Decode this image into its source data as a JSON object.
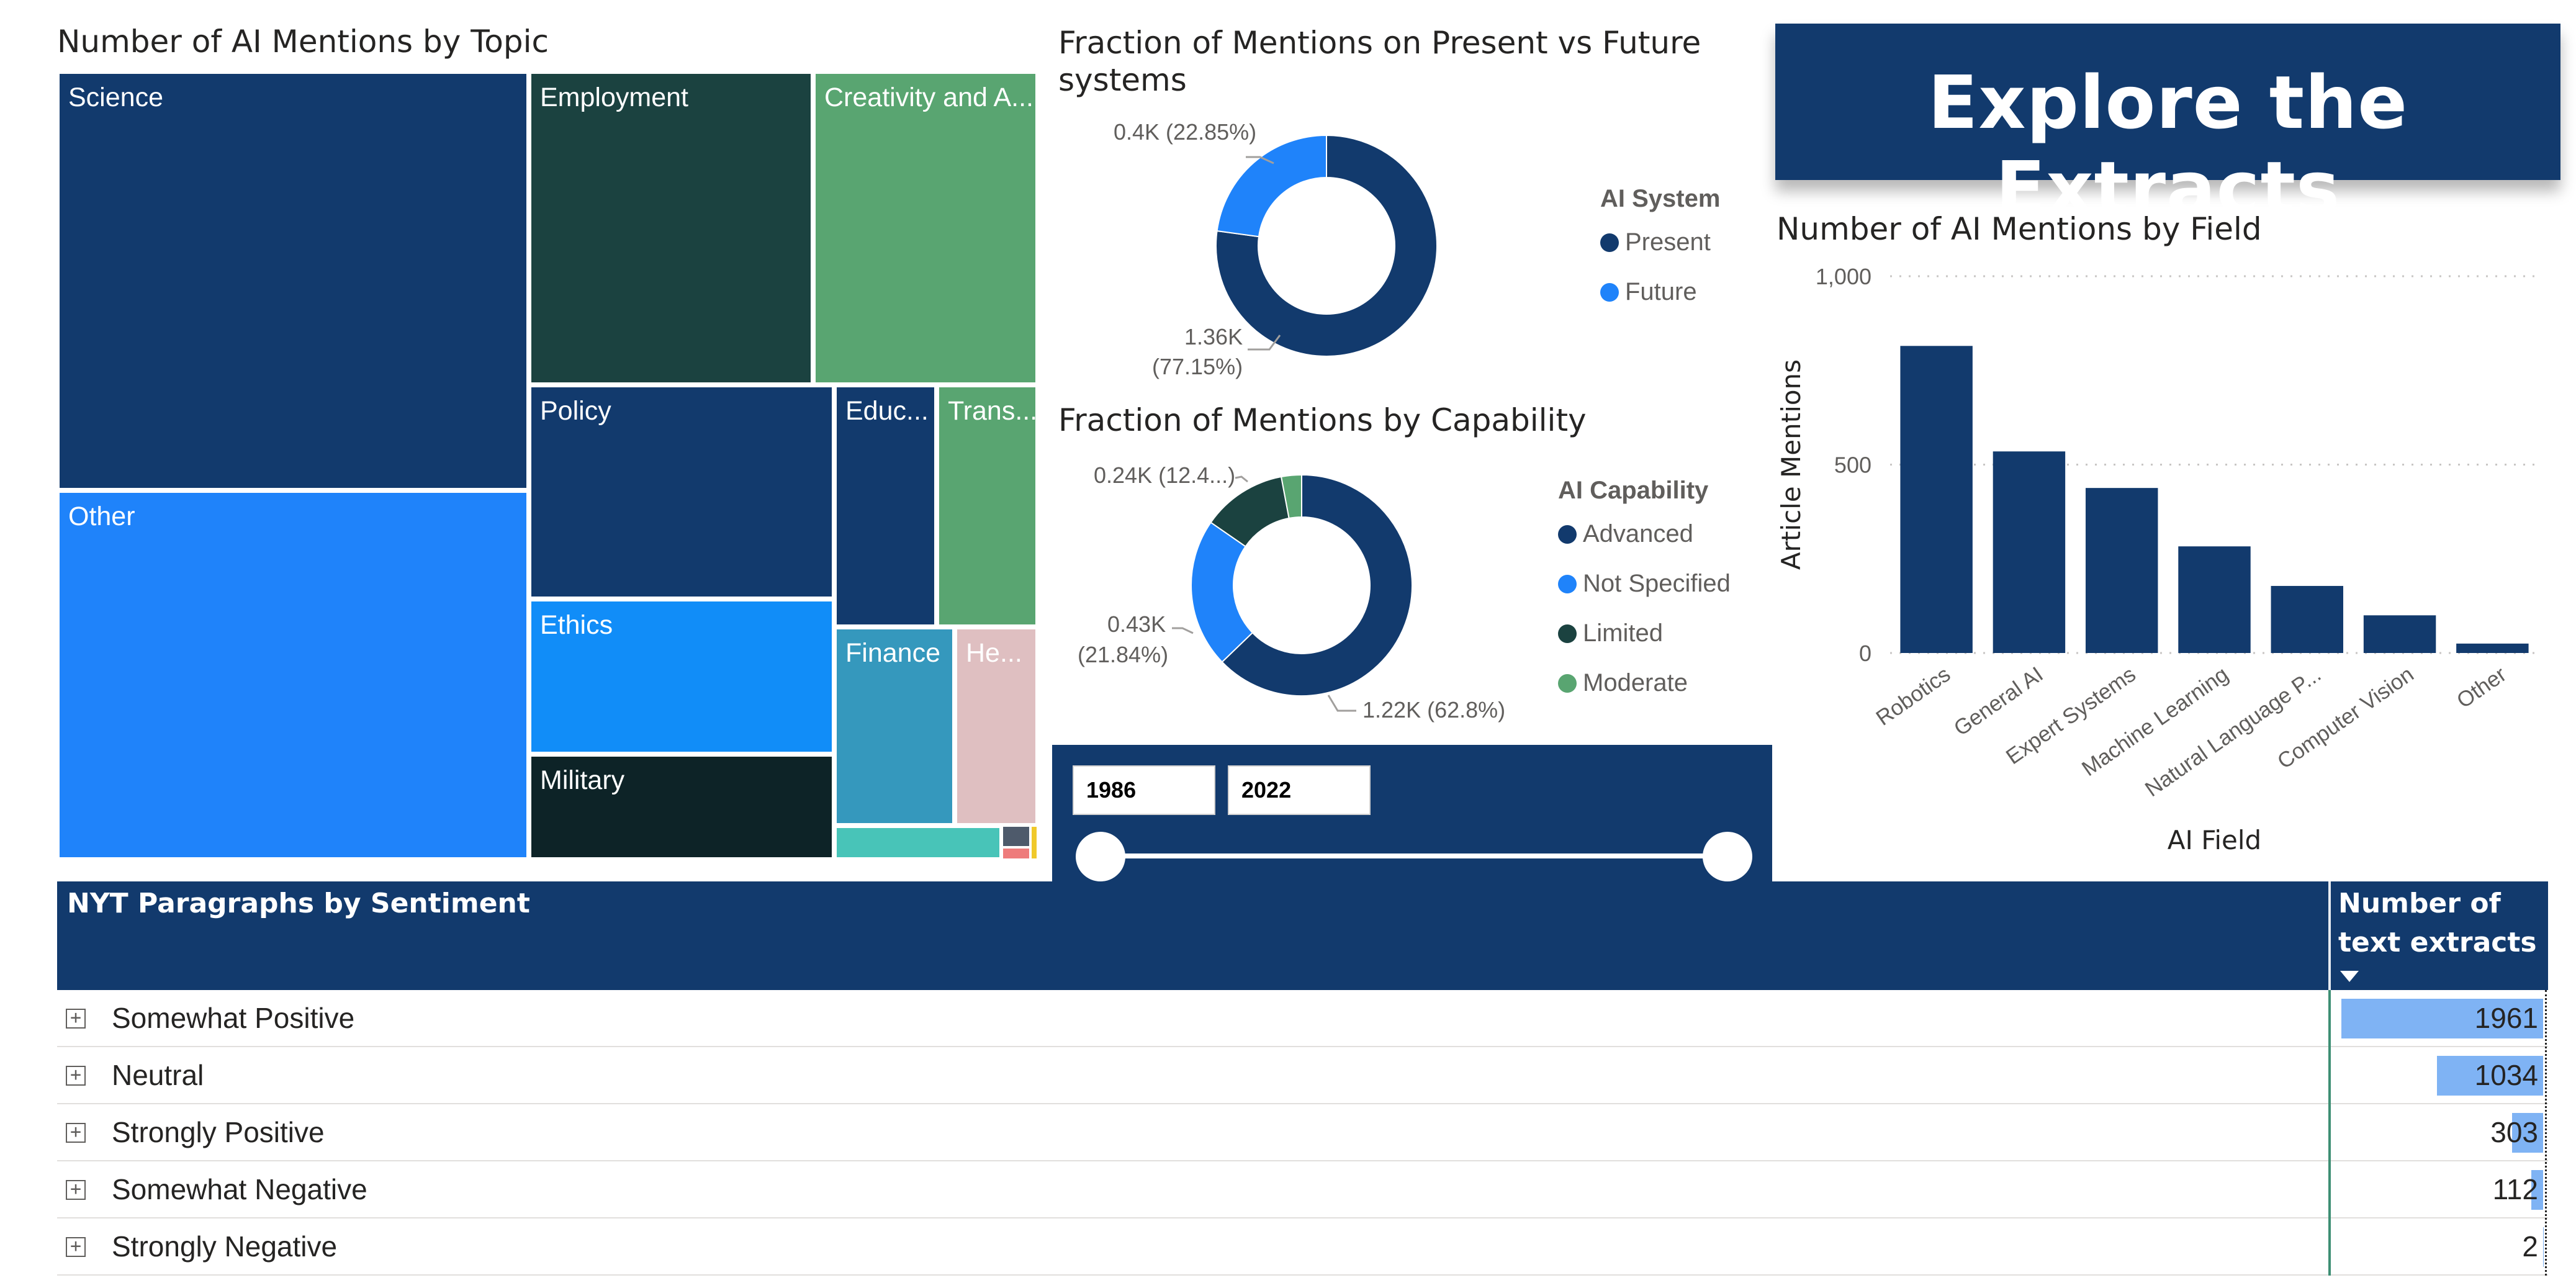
{
  "treemap": {
    "title": "Number of AI Mentions by Topic",
    "tiles": [
      {
        "label": "Science",
        "color": "#123a6d"
      },
      {
        "label": "Other",
        "color": "#1f83fa"
      },
      {
        "label": "Employment",
        "color": "#1b4240"
      },
      {
        "label": "Creativity and A...",
        "color": "#59a571"
      },
      {
        "label": "Policy",
        "color": "#123a6d"
      },
      {
        "label": "Educ...",
        "color": "#123a6d"
      },
      {
        "label": "Trans...",
        "color": "#59a571"
      },
      {
        "label": "Ethics",
        "color": "#118df8"
      },
      {
        "label": "Finance",
        "color": "#3598bd"
      },
      {
        "label": "He...",
        "color": "#dfbfc1"
      },
      {
        "label": "Military",
        "color": "#0d2327"
      },
      {
        "label": "",
        "color": "#48c4b8"
      },
      {
        "label": "",
        "color": "#4e5a6b"
      },
      {
        "label": "",
        "color": "#f0c92b"
      },
      {
        "label": "",
        "color": "#ee7b7b"
      }
    ]
  },
  "donut_system": {
    "title_line1": "Fraction of Mentions on Present vs Future",
    "title_line2": "systems",
    "label_future": "0.4K (22.85%)",
    "label_present_1": "1.36K",
    "label_present_2": "(77.15%)",
    "legend_title": "AI System",
    "legend": [
      {
        "name": "Present",
        "color": "#123a6d"
      },
      {
        "name": "Future",
        "color": "#1f83fa"
      }
    ],
    "chart_data": {
      "type": "pie",
      "categories": [
        "Present",
        "Future"
      ],
      "values": [
        77.15,
        22.85
      ],
      "title": "Fraction of Mentions on Present vs Future systems"
    }
  },
  "donut_capability": {
    "title": "Fraction of Mentions by Capability",
    "label_limited": "0.24K (12.4...)",
    "label_notspec_1": "0.43K",
    "label_notspec_2": "(21.84%)",
    "label_advanced": "1.22K (62.8%)",
    "legend_title": "AI Capability",
    "legend": [
      {
        "name": "Advanced",
        "color": "#123a6d"
      },
      {
        "name": "Not Specified",
        "color": "#1f83fa"
      },
      {
        "name": "Limited",
        "color": "#1b4240"
      },
      {
        "name": "Moderate",
        "color": "#59a571"
      }
    ],
    "chart_data": {
      "type": "pie",
      "categories": [
        "Advanced",
        "Not Specified",
        "Limited",
        "Moderate"
      ],
      "values": [
        62.8,
        21.84,
        12.4,
        2.96
      ],
      "title": "Fraction of Mentions by Capability"
    }
  },
  "banner": {
    "text": "Explore the Extracts"
  },
  "field_chart": {
    "title": "Number of AI Mentions by Field",
    "chart_data": {
      "type": "bar",
      "title": "Number of AI Mentions by Field",
      "categories": [
        "Robotics",
        "General AI",
        "Expert Systems",
        "Machine Learning",
        "Natural Language P...",
        "Computer Vision",
        "Other"
      ],
      "values": [
        815,
        535,
        438,
        283,
        178,
        100,
        25
      ],
      "xlabel": "AI Field",
      "ylabel": "Article Mentions",
      "ylim": [
        0,
        1000
      ],
      "yticks": [
        0,
        500,
        1000
      ],
      "ytick_labels": [
        "0",
        "500",
        "1,000"
      ],
      "grid": true,
      "color": "#123a6d"
    }
  },
  "slicer": {
    "start": "1986",
    "end": "2022"
  },
  "table": {
    "header_left": "NYT Paragraphs by Sentiment",
    "header_right_1": "Number of",
    "header_right_2": "text extracts",
    "expand_glyph": "+",
    "rows": [
      {
        "label": "Somewhat Positive",
        "value": "1961",
        "num": 1961
      },
      {
        "label": "Neutral",
        "value": "1034",
        "num": 1034
      },
      {
        "label": "Strongly Positive",
        "value": "303",
        "num": 303
      },
      {
        "label": "Somewhat Negative",
        "value": "112",
        "num": 112
      },
      {
        "label": "Strongly Negative",
        "value": "2",
        "num": 2
      }
    ]
  }
}
